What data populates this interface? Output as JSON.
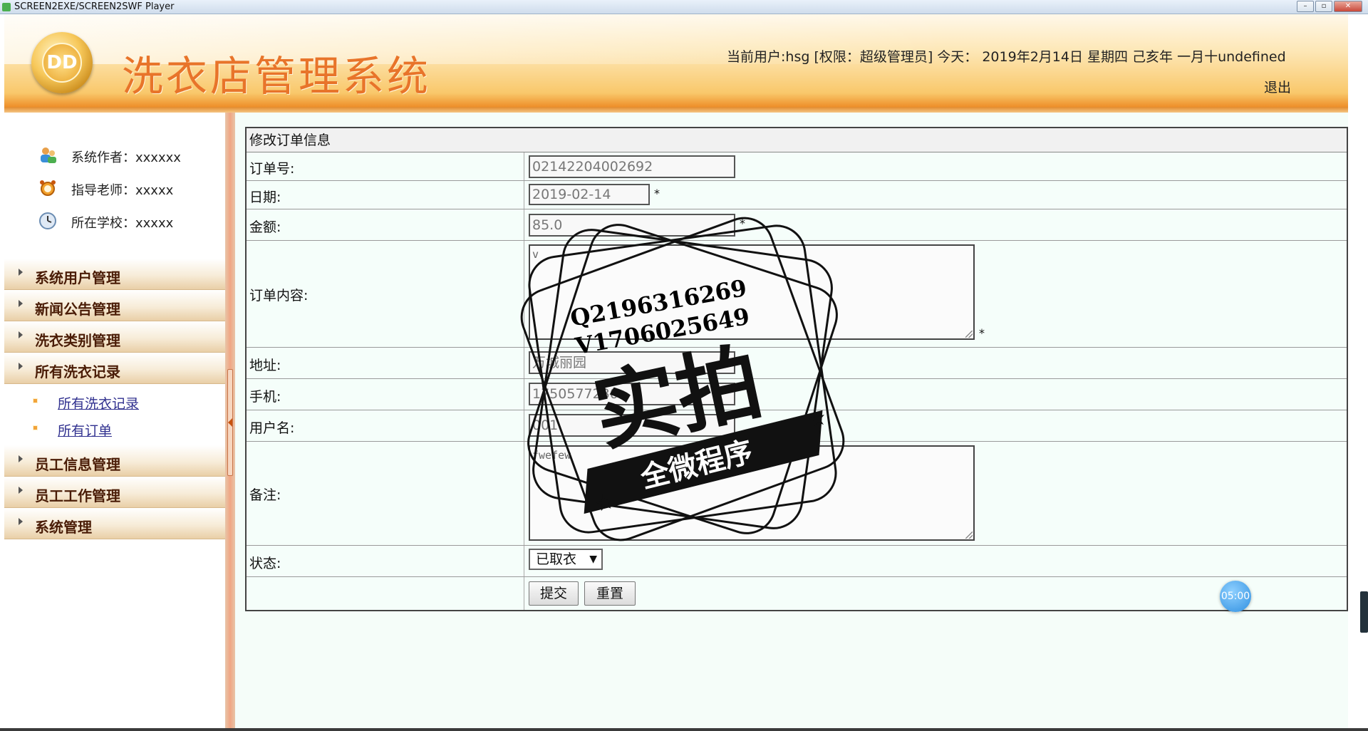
{
  "window": {
    "title": "SCREEN2EXE/SCREEN2SWF Player",
    "minimize": "–",
    "restore": "▫",
    "close": "✕"
  },
  "header": {
    "logo_text": "DD",
    "app_title": "洗衣店管理系统",
    "user_info": "当前用户:hsg [权限：超级管理员] 今天： 2019年2月14日 星期四 己亥年 一月十undefined",
    "logout": "退出"
  },
  "sidebar": {
    "info": [
      {
        "icon": "users-icon",
        "text": "系统作者：xxxxxx"
      },
      {
        "icon": "alarm-clock-icon",
        "text": "指导老师：xxxxx"
      },
      {
        "icon": "clock-icon",
        "text": "所在学校：xxxxx"
      }
    ],
    "menu": [
      {
        "label": "系统用户管理"
      },
      {
        "label": "新闻公告管理"
      },
      {
        "label": "洗衣类别管理"
      },
      {
        "label": "所有洗衣记录",
        "submenu": [
          "所有洗衣记录",
          "所有订单"
        ]
      },
      {
        "label": "员工信息管理"
      },
      {
        "label": "员工工作管理"
      },
      {
        "label": "系统管理"
      }
    ]
  },
  "form": {
    "title": "修改订单信息",
    "fields": {
      "order_no": {
        "label": "订单号:",
        "value": "02142204002692"
      },
      "date": {
        "label": "日期:",
        "value": "2019-02-14",
        "required": "*"
      },
      "amount": {
        "label": "金额:",
        "value": "85.0",
        "required": "*"
      },
      "content": {
        "label": "订单内容:",
        "value": "v",
        "required": "*"
      },
      "address": {
        "label": "地址:",
        "value": "万城丽园"
      },
      "phone": {
        "label": "手机:",
        "value": "1750577230"
      },
      "username": {
        "label": "用户名:",
        "value": "001"
      },
      "remark": {
        "label": "备注:",
        "value": "fwefew"
      },
      "status": {
        "label": "状态:",
        "value": "已取衣"
      }
    },
    "submit": "提交",
    "reset": "重置"
  },
  "watermark": {
    "line1": "Q2196316269",
    "line2": "V1706025649",
    "main": "实拍",
    "banner": "全微程序"
  },
  "timer": "05:00"
}
